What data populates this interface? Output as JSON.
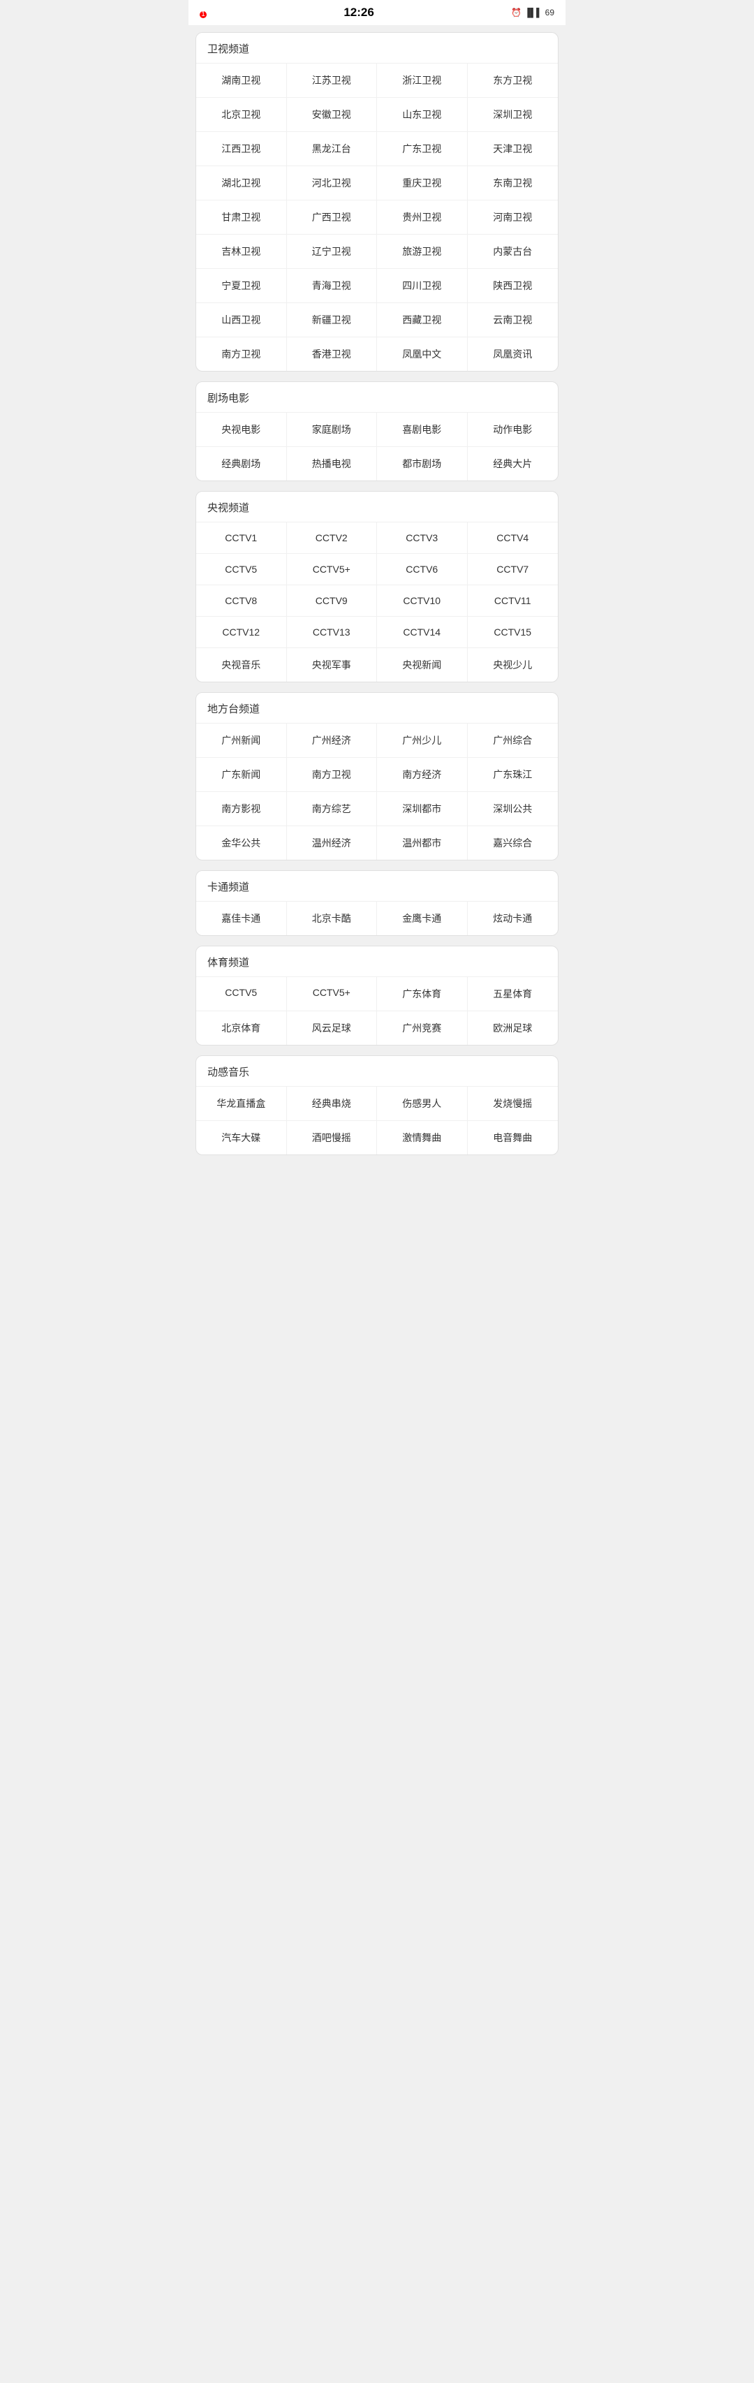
{
  "statusBar": {
    "time": "12:26",
    "notification": "1",
    "batteryLabel": "69"
  },
  "sections": [
    {
      "id": "satellite",
      "title": "卫视频道",
      "items": [
        "湖南卫视",
        "江苏卫视",
        "浙江卫视",
        "东方卫视",
        "北京卫视",
        "安徽卫视",
        "山东卫视",
        "深圳卫视",
        "江西卫视",
        "黑龙江台",
        "广东卫视",
        "天津卫视",
        "湖北卫视",
        "河北卫视",
        "重庆卫视",
        "东南卫视",
        "甘肃卫视",
        "广西卫视",
        "贵州卫视",
        "河南卫视",
        "吉林卫视",
        "辽宁卫视",
        "旅游卫视",
        "内蒙古台",
        "宁夏卫视",
        "青海卫视",
        "四川卫视",
        "陕西卫视",
        "山西卫视",
        "新疆卫视",
        "西藏卫视",
        "云南卫视",
        "南方卫视",
        "香港卫视",
        "凤凰中文",
        "凤凰资讯"
      ]
    },
    {
      "id": "theater",
      "title": "剧场电影",
      "items": [
        "央视电影",
        "家庭剧场",
        "喜剧电影",
        "动作电影",
        "经典剧场",
        "热播电视",
        "都市剧场",
        "经典大片"
      ]
    },
    {
      "id": "cctv",
      "title": "央视频道",
      "items": [
        "CCTV1",
        "CCTV2",
        "CCTV3",
        "CCTV4",
        "CCTV5",
        "CCTV5+",
        "CCTV6",
        "CCTV7",
        "CCTV8",
        "CCTV9",
        "CCTV10",
        "CCTV11",
        "CCTV12",
        "CCTV13",
        "CCTV14",
        "CCTV15",
        "央视音乐",
        "央视军事",
        "央视新闻",
        "央视少儿"
      ]
    },
    {
      "id": "local",
      "title": "地方台频道",
      "items": [
        "广州新闻",
        "广州经济",
        "广州少儿",
        "广州综合",
        "广东新闻",
        "南方卫视",
        "南方经济",
        "广东珠江",
        "南方影视",
        "南方综艺",
        "深圳都市",
        "深圳公共",
        "金华公共",
        "温州经济",
        "温州都市",
        "嘉兴综合"
      ]
    },
    {
      "id": "cartoon",
      "title": "卡通频道",
      "items": [
        "嘉佳卡通",
        "北京卡酷",
        "金鹰卡通",
        "炫动卡通"
      ]
    },
    {
      "id": "sports",
      "title": "体育频道",
      "items": [
        "CCTV5",
        "CCTV5+",
        "广东体育",
        "五星体育",
        "北京体育",
        "风云足球",
        "广州竞赛",
        "欧洲足球"
      ]
    },
    {
      "id": "music",
      "title": "动感音乐",
      "items": [
        "华龙直播盒",
        "经典串烧",
        "伤感男人",
        "发烧慢摇",
        "汽车大碟",
        "酒吧慢摇",
        "激情舞曲",
        "电音舞曲"
      ]
    }
  ]
}
